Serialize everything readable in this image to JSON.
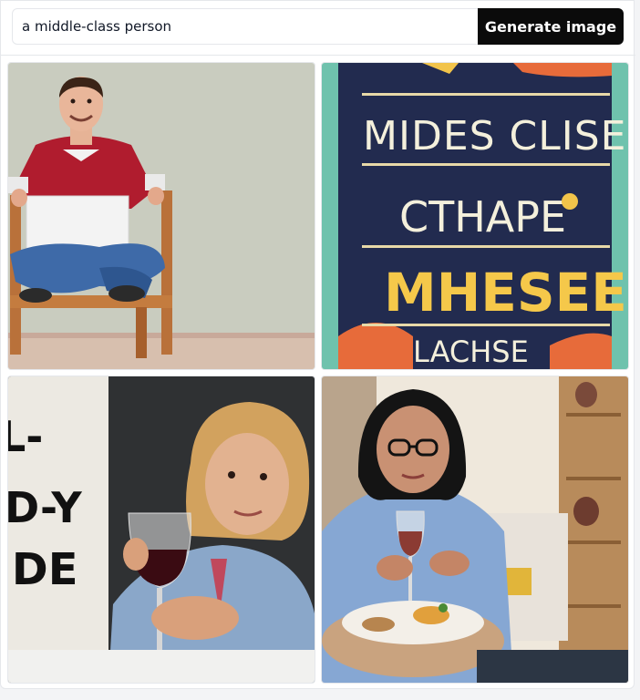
{
  "search": {
    "value": "a middle-class person"
  },
  "toolbar": {
    "generate_label": "Generate image"
  },
  "images": [
    {
      "name": "man-with-laptop"
    },
    {
      "name": "typographic-poster",
      "text_lines": [
        "MIDES CLISES E",
        "CTHAPE",
        "MHESEE",
        "LACHSE"
      ]
    },
    {
      "name": "woman-with-wine-sign",
      "sign_lines": [
        "L-",
        "D-Y",
        "IDE"
      ]
    },
    {
      "name": "woman-with-glasses-at-table"
    }
  ]
}
